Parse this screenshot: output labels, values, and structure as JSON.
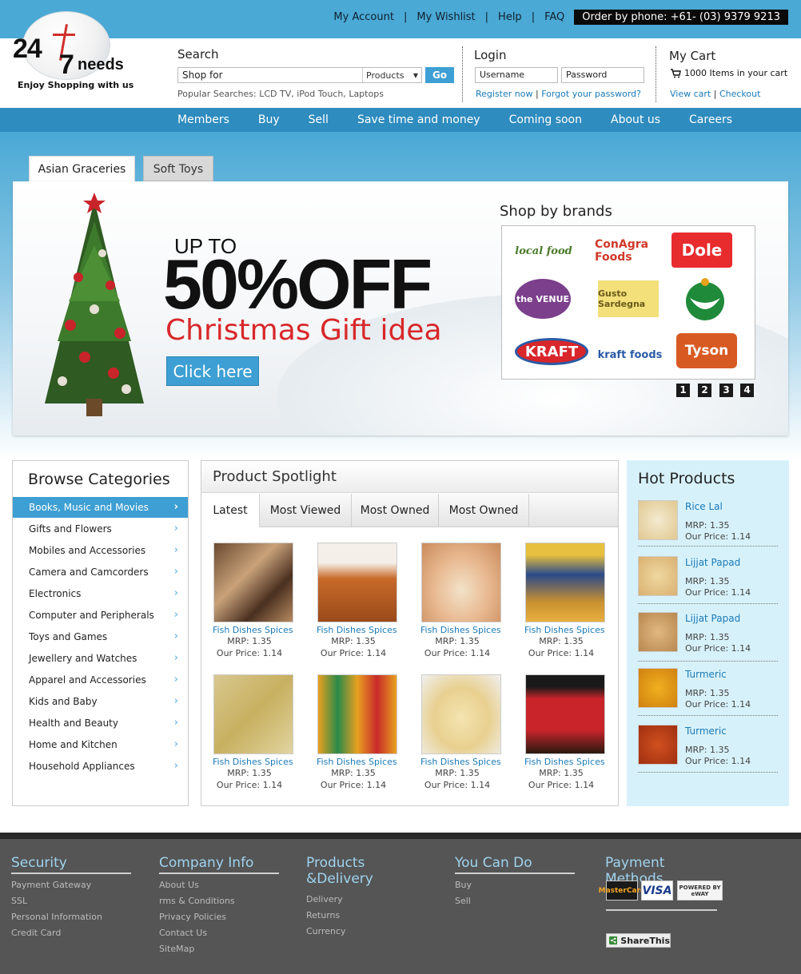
{
  "top_links": [
    "My Account",
    "My Wishlist",
    "Help",
    "FAQ"
  ],
  "phone": "Order by phone: +61- (03) 9379 9213",
  "logo": {
    "num": "24",
    "seven": "7",
    "needs": "needs",
    "tagline": "Enjoy Shopping with us"
  },
  "search": {
    "label": "Search",
    "placeholder": "Shop for",
    "category": "Products",
    "go": "Go",
    "popular": "Popular Searches: LCD TV, iPod Touch, Laptops"
  },
  "login": {
    "label": "Login",
    "username": "Username",
    "password": "Password",
    "register": "Register now",
    "forgot": "Forgot your password?"
  },
  "cart": {
    "label": "My Cart",
    "items": "1000 Items in your cart",
    "view": "View cart",
    "checkout": "Checkout"
  },
  "nav": [
    "Members",
    "Buy",
    "Sell",
    "Save time and money",
    "Coming soon",
    "About us",
    "Careers"
  ],
  "banner": {
    "tabs": [
      "Asian Graceries",
      "Soft Toys"
    ],
    "upto": "UP TO",
    "off": "50%OFF",
    "headline": "Christmas Gift idea",
    "cta": "Click here",
    "brands_title": "Shop by brands",
    "brands": [
      "local food",
      "ConAgra Foods",
      "Dole",
      "the VENUE",
      "Gusto Sardegna",
      "",
      "KRAFT",
      "kraft foods",
      "Tyson"
    ],
    "pages": [
      "1",
      "2",
      "3",
      "4"
    ]
  },
  "categories": {
    "title": "Browse Categories",
    "items": [
      "Books, Music and Movies",
      "Gifts and Flowers",
      "Mobiles and Accessories",
      "Camera and Camcorders",
      "Electronics",
      "Computer and Peripherals",
      "Toys and Games",
      "Jewellery and Watches",
      "Apparel and Accessories",
      "Kids and Baby",
      "Health and Beauty",
      "Home and Kitchen",
      "Household Appliances"
    ]
  },
  "spotlight": {
    "title": "Product Spotlight",
    "tabs": [
      "Latest",
      "Most Viewed",
      "Most Owned",
      "Most Owned"
    ],
    "products": [
      {
        "name": "Fish Dishes Spices",
        "mrp": "MRP: 1.35",
        "price": "Our Price: 1.14"
      },
      {
        "name": "Fish Dishes Spices",
        "mrp": "MRP: 1.35",
        "price": "Our Price: 1.14"
      },
      {
        "name": "Fish Dishes Spices",
        "mrp": "MRP: 1.35",
        "price": "Our Price: 1.14"
      },
      {
        "name": "Fish Dishes Spices",
        "mrp": "MRP: 1.35",
        "price": "Our Price: 1.14"
      },
      {
        "name": "Fish Dishes Spices",
        "mrp": "MRP: 1.35",
        "price": "Our Price: 1.14"
      },
      {
        "name": "Fish Dishes Spices",
        "mrp": "MRP: 1.35",
        "price": "Our Price: 1.14"
      },
      {
        "name": "Fish Dishes Spices",
        "mrp": "MRP: 1.35",
        "price": "Our Price: 1.14"
      },
      {
        "name": "Fish Dishes Spices",
        "mrp": "MRP: 1.35",
        "price": "Our Price: 1.14"
      }
    ]
  },
  "hot": {
    "title": "Hot Products",
    "items": [
      {
        "name": "Rice Lal",
        "mrp": "MRP: 1.35",
        "price": "Our Price: 1.14"
      },
      {
        "name": "Lijjat Papad",
        "mrp": "MRP: 1.35",
        "price": "Our Price: 1.14"
      },
      {
        "name": "Lijjat Papad",
        "mrp": "MRP: 1.35",
        "price": "Our Price: 1.14"
      },
      {
        "name": "Turmeric",
        "mrp": "MRP: 1.35",
        "price": "Our Price: 1.14"
      },
      {
        "name": "Turmeric",
        "mrp": "MRP: 1.35",
        "price": "Our Price: 1.14"
      }
    ]
  },
  "footer": {
    "security": {
      "title": "Security",
      "links": [
        "Payment Gateway",
        "SSL",
        "Personal Information",
        "Credit Card"
      ]
    },
    "company": {
      "title": "Company Info",
      "links": [
        "About Us",
        "rms & Conditions",
        "Privacy Policies",
        "Contact Us",
        "SiteMap"
      ]
    },
    "products": {
      "title": "Products &Delivery",
      "links": [
        "Delivery",
        "Returns",
        "Currency"
      ]
    },
    "youcan": {
      "title": "You Can Do",
      "links": [
        "Buy",
        "Sell"
      ]
    },
    "payment": {
      "title": "Payment Methods",
      "cards": [
        "MasterCard",
        "VISA",
        "POWERED BY eWAY"
      ]
    },
    "share": "ShareThis"
  },
  "colors": {
    "accent": "#3d9fd3",
    "topbar": "#4aa9d5",
    "nav": "#2e8cbf",
    "link": "#1a7ab8",
    "footer": "#555555",
    "footer_heading": "#9fd3ee",
    "promo_red": "#d8282a"
  }
}
